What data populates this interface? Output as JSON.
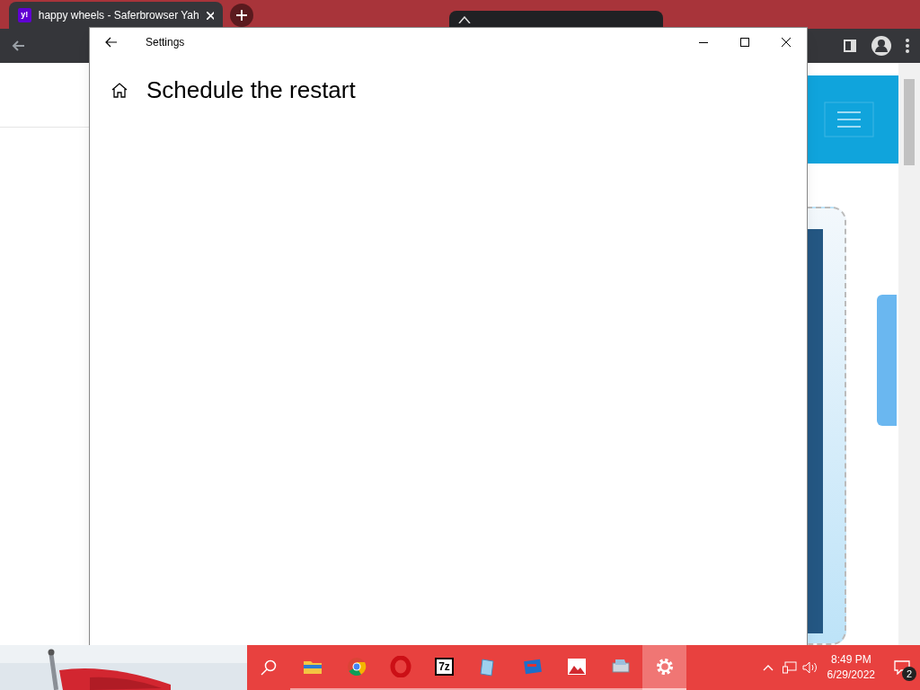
{
  "browser": {
    "tabs": [
      {
        "title": "happy wheels - Saferbrowser Yah",
        "favicon": "y!",
        "selected": true
      },
      {
        "selected": false
      }
    ]
  },
  "settings_window": {
    "title": "Settings",
    "heading": "Schedule the restart"
  },
  "taskbar": {
    "apps": [
      {
        "kind": "folder",
        "selected": false
      },
      {
        "kind": "chrome",
        "selected": false
      },
      {
        "kind": "opera",
        "selected": false
      },
      {
        "kind": "archive",
        "label": "7z",
        "selected": false
      },
      {
        "kind": "notepad",
        "selected": false
      },
      {
        "kind": "book",
        "selected": false
      },
      {
        "kind": "photos",
        "selected": false
      },
      {
        "kind": "scanner",
        "selected": false
      },
      {
        "kind": "settings",
        "selected": true
      }
    ],
    "time": "8:49 PM",
    "date": "6/29/2022",
    "notifications": "2"
  }
}
